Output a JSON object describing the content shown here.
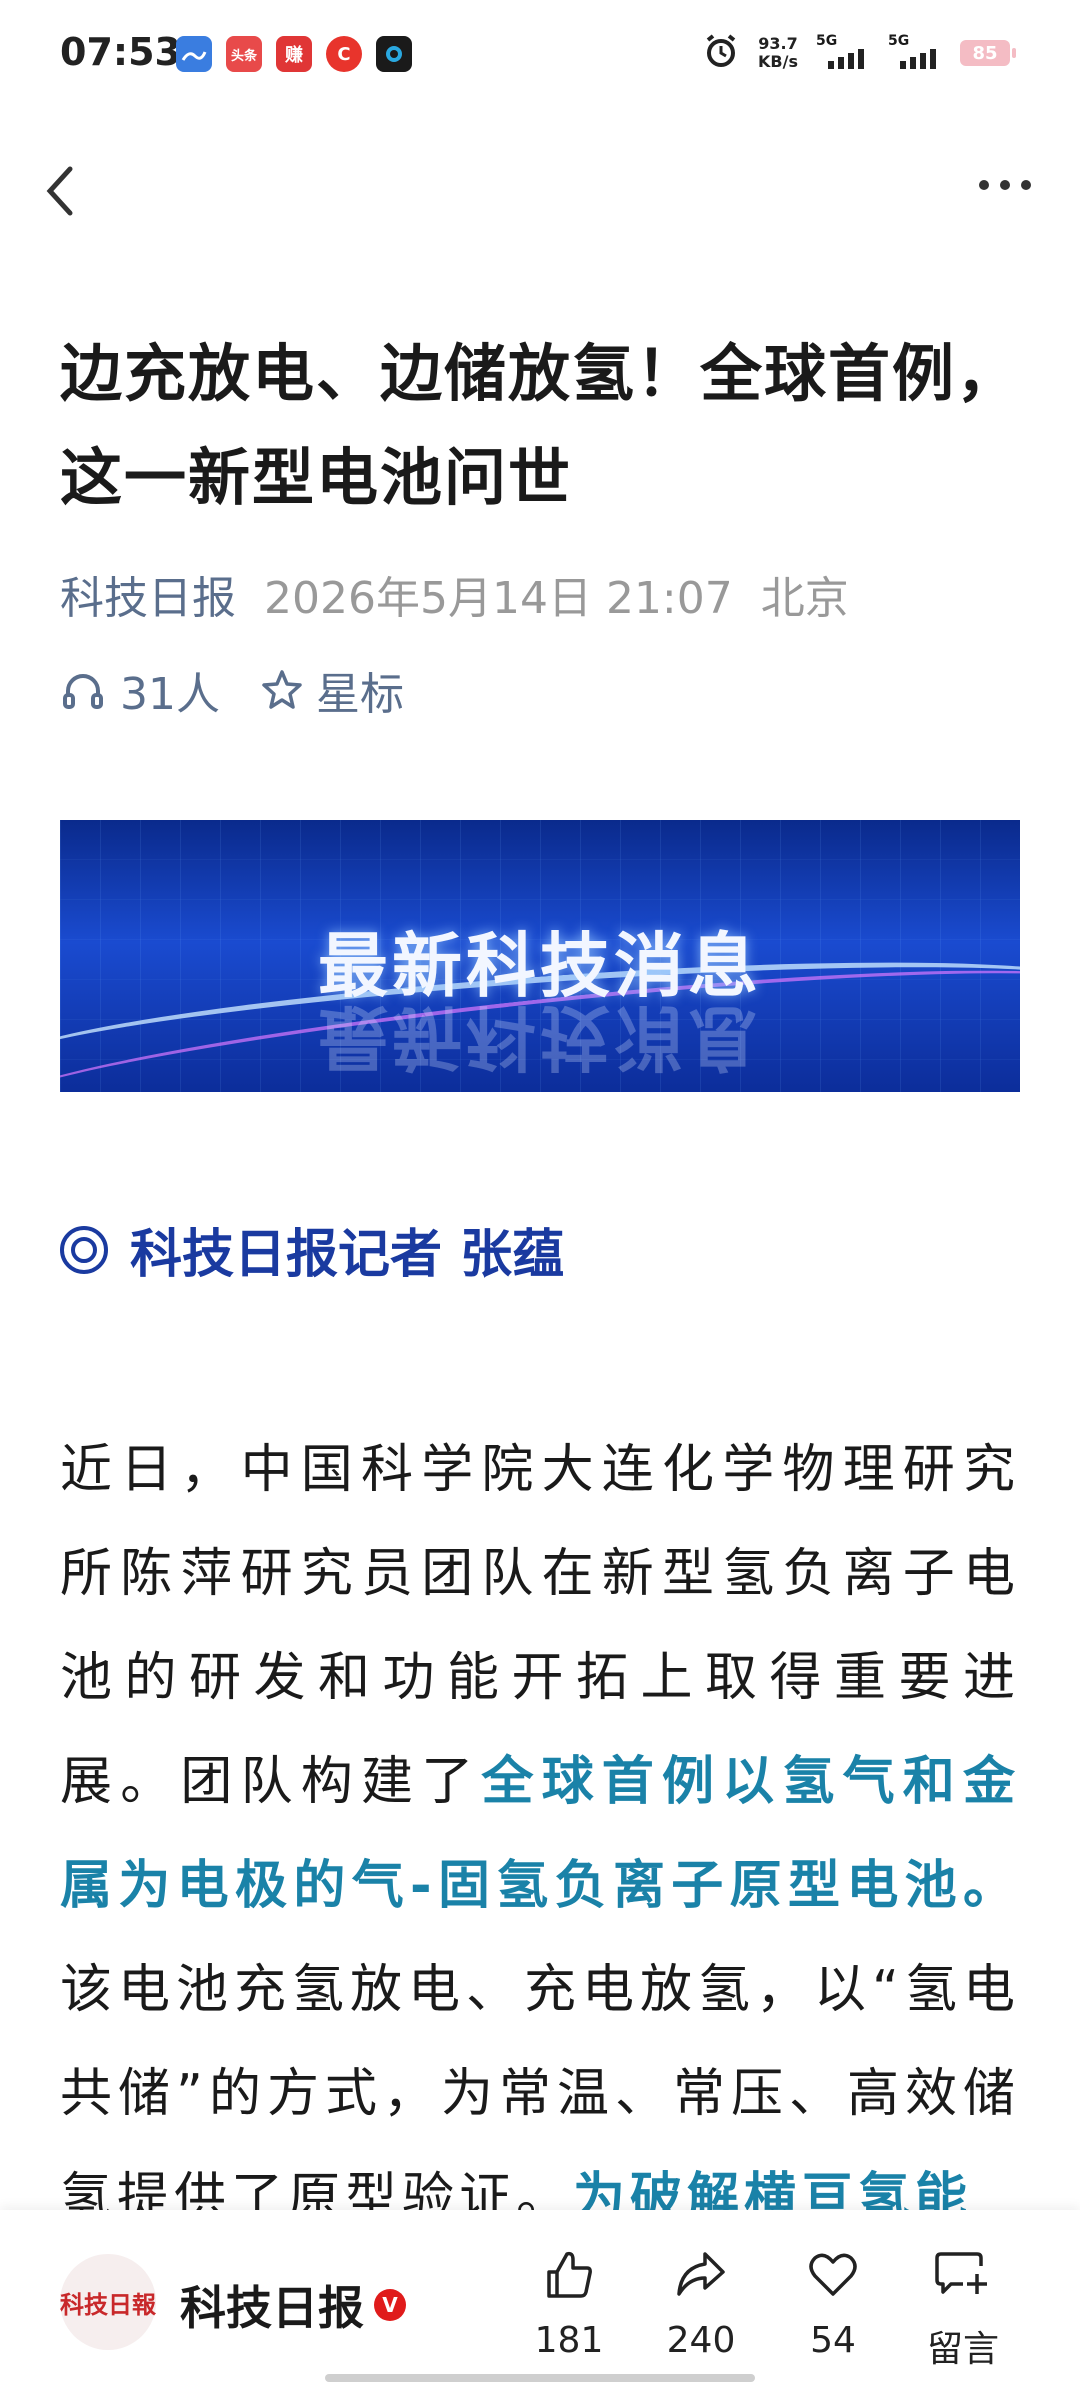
{
  "status_bar": {
    "time": "07:53",
    "app_icons": [
      {
        "name": "weather-app-icon",
        "text": "",
        "color": "#3a7de0"
      },
      {
        "name": "toutiao-app-icon",
        "text": "头条",
        "color": "#e84a4a"
      },
      {
        "name": "zhuan-app-icon",
        "text": "赚",
        "color": "#e03636"
      },
      {
        "name": "c-app-icon",
        "text": "C",
        "color": "#e8342c"
      },
      {
        "name": "camera-app-icon",
        "text": "",
        "color": "#1a1a1a"
      }
    ],
    "net_speed_value": "93.7",
    "net_speed_unit": "KB/s",
    "signal_1": "5G",
    "signal_2": "5G",
    "battery": "85"
  },
  "article": {
    "title": "边充放电、边储放氢！全球首例，这一新型电池问世",
    "source": "科技日报",
    "date": "2026年5月14日 21:07",
    "location": "北京",
    "listeners": "31人",
    "star_label": "星标",
    "banner_text": "最新科技消息",
    "reporter": "科技日报记者 张蕴",
    "body": {
      "p1_a": "近日，中国科学院大连化学物理研究所陈萍研究员团队在新型氢负离子电池的研发和功能开拓上取得重要进展。团队构建了",
      "p1_hl": "全球首例以氢气和金属为电极的气-固氢负离子原型电池。",
      "p1_b": "该电池充氢放电、充电放氢，以“氢电共储”的方式，为常温、常压、高效储氢提供了原型验证。",
      "p1_hl2": "为破解横亘氢能"
    }
  },
  "bottom_bar": {
    "account_logo_text": "科技日報",
    "account_name": "科技日报",
    "verified_badge": "V",
    "like_count": "181",
    "share_count": "240",
    "favorite_count": "54",
    "comment_label": "留言"
  }
}
